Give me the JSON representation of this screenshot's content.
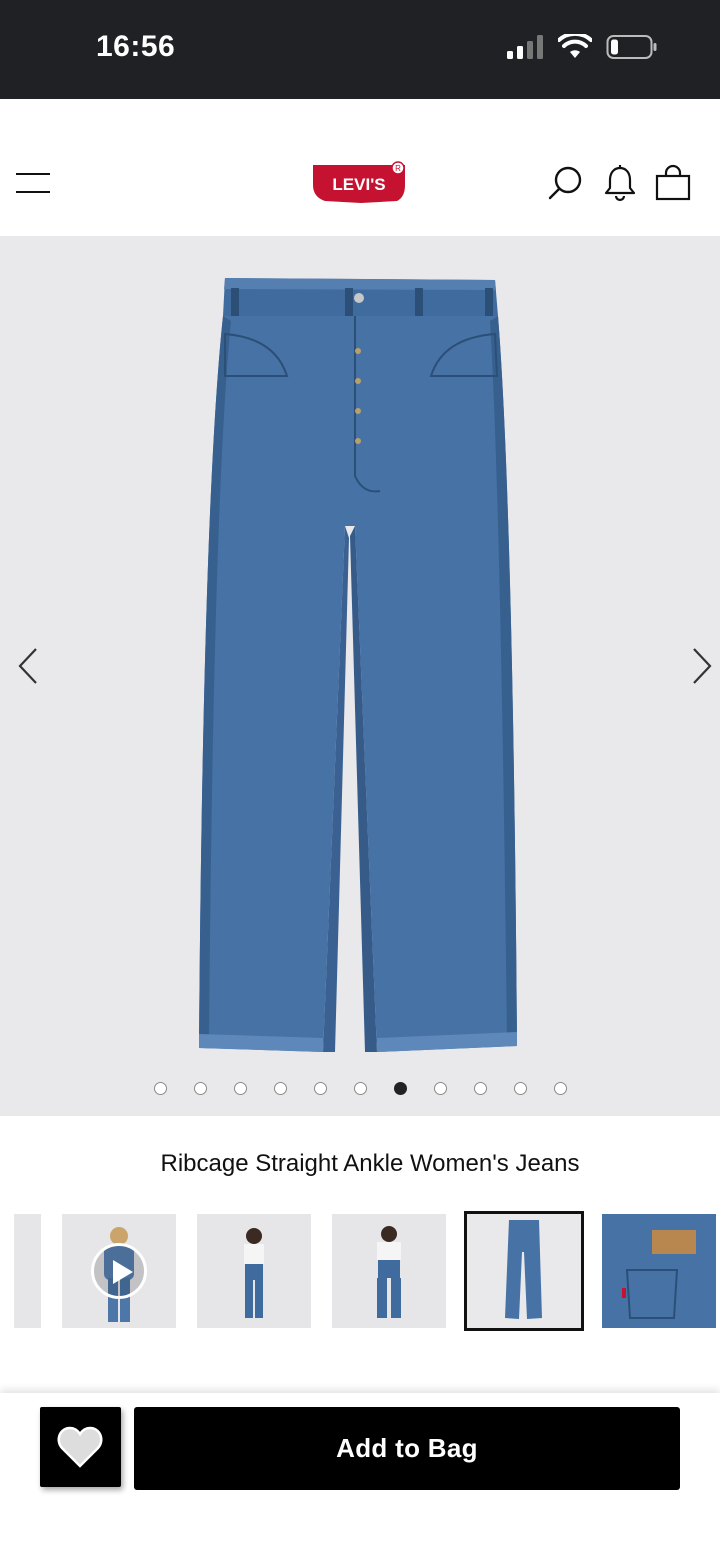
{
  "status_bar": {
    "time": "16:56"
  },
  "header": {
    "logo_text": "Levi's"
  },
  "product": {
    "title": "Ribcage Straight Ankle Women's Jeans"
  },
  "gallery": {
    "dot_count": 11,
    "active_dot": 6
  },
  "bottom_bar": {
    "add_to_bag_label": "Add to Bag"
  },
  "colors": {
    "brand_red": "#c41230",
    "denim": "#3f6b9e",
    "gallery_bg": "#e9e8ea"
  }
}
